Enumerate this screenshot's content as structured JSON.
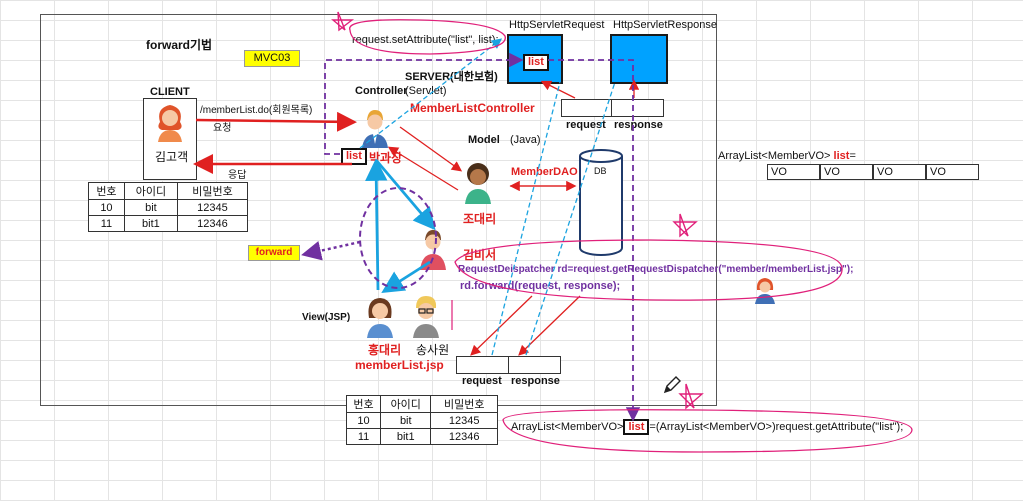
{
  "title": "forward기법",
  "mvc_label": "MVC03",
  "set_attribute_code": "request.setAttribute(\"list\", list);",
  "http_request_label": "HttpServletRequest",
  "http_response_label": "HttpServletResponse",
  "list_label": "list",
  "server_label": "SERVER(대한보험)",
  "client": {
    "label": "CLIENT",
    "name": "김고객",
    "request_url": "/memberList.do(회원목록)",
    "request_word": "요청",
    "response_word": "응답"
  },
  "controller": {
    "label": "Controller",
    "sub": "(Servlet)",
    "class_name": "MemberListController",
    "person": "박과장"
  },
  "req_resp_top": {
    "request": "request",
    "response": "response"
  },
  "model": {
    "label": "Model",
    "sub": "(Java)",
    "dao": "MemberDAO",
    "person": "조대리"
  },
  "db_label": "DB",
  "arraylist_label": "ArrayList<MemberVO>",
  "arraylist_var": "list",
  "arraylist_eq": "=",
  "vo_cells": [
    "VO",
    "VO",
    "VO",
    "VO"
  ],
  "forward_tag": "forward",
  "kim_label": "김비서",
  "dispatcher_code": "RequestDeispatcher rd=request.getRequestDispatcher(\"member/memberList.jsp\");",
  "forward_code": "rd.forward(request, response);",
  "view": {
    "label": "View(JSP)",
    "person1": "홍대리",
    "person2": "송사원",
    "file": "memberList.jsp"
  },
  "req_resp_bottom": {
    "request": "request",
    "response": "response"
  },
  "client_table": {
    "headers": [
      "번호",
      "아이디",
      "비밀번호"
    ],
    "rows": [
      [
        "10",
        "bit",
        "12345"
      ],
      [
        "11",
        "bit1",
        "12346"
      ]
    ]
  },
  "bottom_table": {
    "headers": [
      "번호",
      "아이디",
      "비밀번호"
    ],
    "rows": [
      [
        "10",
        "bit",
        "12345"
      ],
      [
        "11",
        "bit1",
        "12346"
      ]
    ]
  },
  "get_attribute": {
    "prefix": "ArrayList<MemberVO>",
    "var": "list",
    "suffix": "=(ArrayList<MemberVO>)request.getAttribute(\"list\");"
  },
  "colors": {
    "red_arrow": "#e02020",
    "blue_arrow": "#1aa3e0",
    "purple_dash": "#7030a0",
    "pink_annotation": "#e0207a",
    "blue_box": "#00a2ff",
    "db_stroke": "#1f3a6b"
  }
}
